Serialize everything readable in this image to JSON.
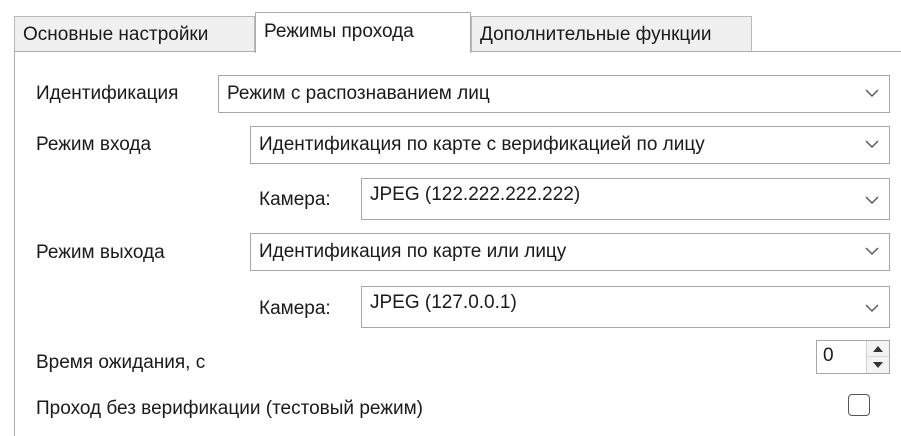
{
  "tabs": [
    {
      "label": "Основные настройки",
      "active": false
    },
    {
      "label": "Режимы прохода",
      "active": true
    },
    {
      "label": "Дополнительные функции",
      "active": false
    }
  ],
  "identification": {
    "label": "Идентификация",
    "value": "Режим с распознаванием лиц"
  },
  "entry_mode": {
    "label": "Режим входа",
    "value": "Идентификация по карте с верификацией по лицу",
    "camera_label": "Камера:",
    "camera_value": "JPEG (122.222.222.222)"
  },
  "exit_mode": {
    "label": "Режим выхода",
    "value": "Идентификация по карте или лицу",
    "camera_label": "Камера:",
    "camera_value": "JPEG (127.0.0.1)"
  },
  "wait_time": {
    "label": "Время ожидания, с",
    "value": "0"
  },
  "no_verification": {
    "label": "Проход без верификации (тестовый режим)",
    "checked": false
  },
  "icons": {
    "dropdown": "chevron-down-icon",
    "spin_up": "arrow-up-icon",
    "spin_down": "arrow-down-icon"
  }
}
